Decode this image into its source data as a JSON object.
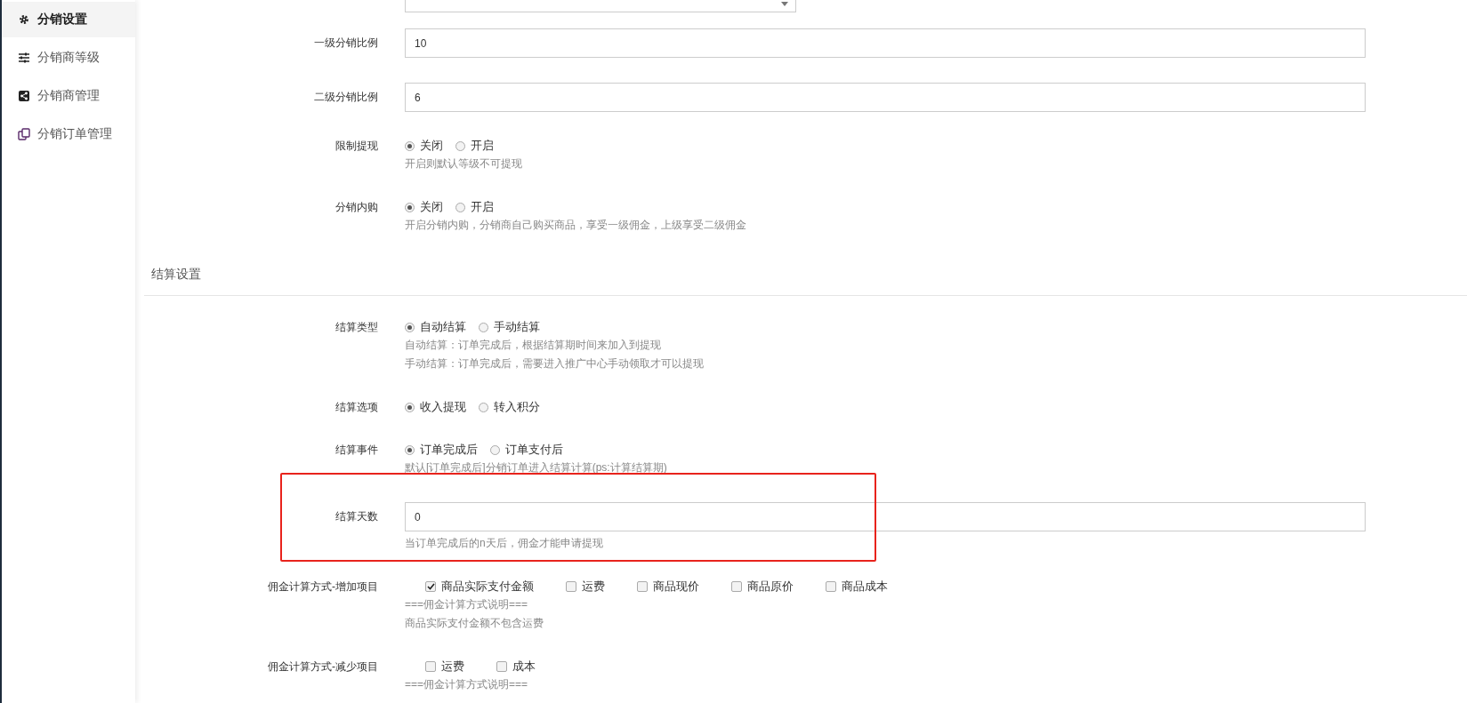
{
  "sidebar": {
    "items": [
      {
        "label": "分销设置",
        "selected": true
      },
      {
        "label": "分销商等级",
        "selected": false
      },
      {
        "label": "分销商管理",
        "selected": false
      },
      {
        "label": "分销订单管理",
        "selected": false
      }
    ]
  },
  "sections": [
    {
      "fields": [
        {
          "kind": "select"
        },
        {
          "kind": "input",
          "label": "一级分销比例",
          "value": "10"
        },
        {
          "kind": "input",
          "label": "二级分销比例",
          "value": "6"
        },
        {
          "kind": "radio",
          "label": "限制提现",
          "options": [
            {
              "label": "关闭",
              "selected": true
            },
            {
              "label": "开启",
              "selected": false
            }
          ],
          "hints": [
            "开启则默认等级不可提现"
          ]
        },
        {
          "kind": "radio",
          "label": "分销内购",
          "options": [
            {
              "label": "关闭",
              "selected": true
            },
            {
              "label": "开启",
              "selected": false
            }
          ],
          "hints": [
            "开启分销内购，分销商自己购买商品，享受一级佣金，上级享受二级佣金"
          ]
        }
      ]
    },
    {
      "title": "结算设置",
      "fields": [
        {
          "kind": "radio",
          "label": "结算类型",
          "options": [
            {
              "label": "自动结算",
              "selected": true
            },
            {
              "label": "手动结算",
              "selected": false
            }
          ],
          "hints": [
            "自动结算：订单完成后，根据结算期时间来加入到提现",
            "手动结算：订单完成后，需要进入推广中心手动领取才可以提现"
          ]
        },
        {
          "kind": "radio",
          "label": "结算选项",
          "options": [
            {
              "label": "收入提现",
              "selected": true
            },
            {
              "label": "转入积分",
              "selected": false
            }
          ]
        },
        {
          "kind": "radio",
          "label": "结算事件",
          "options": [
            {
              "label": "订单完成后",
              "selected": true
            },
            {
              "label": "订单支付后",
              "selected": false
            }
          ],
          "hints": [
            "默认[订单完成后]分销订单进入结算计算(ps:计算结算期)"
          ]
        },
        {
          "kind": "input",
          "label": "结算天数",
          "value": "0",
          "highlighted": true,
          "hints": [
            "当订单完成后的n天后，佣金才能申请提现"
          ]
        },
        {
          "kind": "checkbox",
          "label": "佣金计算方式-增加项目",
          "options": [
            {
              "label": "商品实际支付金额",
              "checked": true
            },
            {
              "label": "运费",
              "checked": false
            },
            {
              "label": "商品现价",
              "checked": false
            },
            {
              "label": "商品原价",
              "checked": false
            },
            {
              "label": "商品成本",
              "checked": false
            }
          ],
          "hints": [
            "===佣金计算方式说明===",
            "商品实际支付金额不包含运费"
          ]
        },
        {
          "kind": "checkbox",
          "label": "佣金计算方式-减少项目",
          "options": [
            {
              "label": "运费",
              "checked": false
            },
            {
              "label": "成本",
              "checked": false
            }
          ],
          "hints": [
            "===佣金计算方式说明==="
          ]
        }
      ]
    }
  ]
}
